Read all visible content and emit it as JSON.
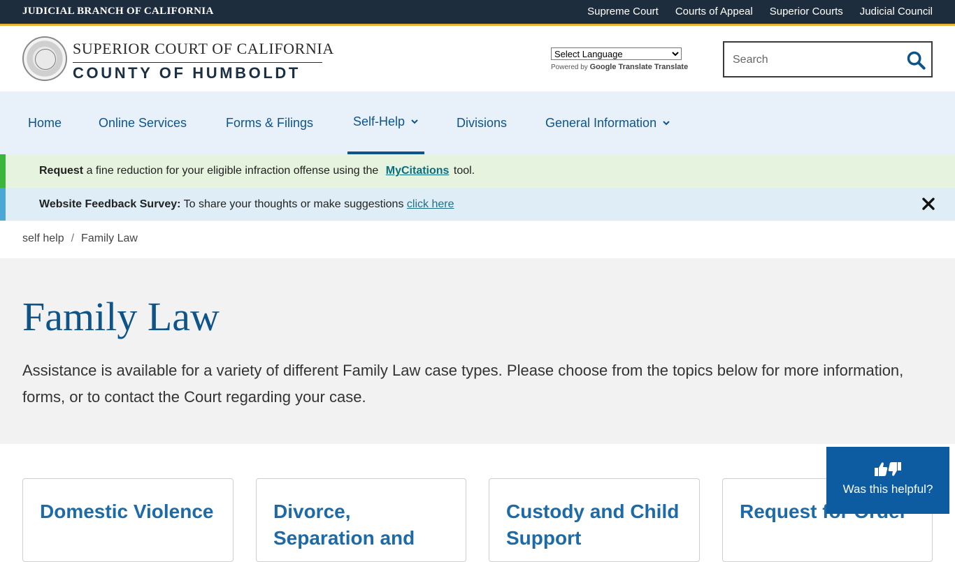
{
  "topbar": {
    "brand": "JUDICIAL BRANCH OF CALIFORNIA",
    "links": [
      "Supreme Court",
      "Courts of Appeal",
      "Superior Courts",
      "Judicial Council"
    ]
  },
  "header": {
    "line1": "SUPERIOR COURT OF CALIFORNIA",
    "line2": "COUNTY OF HUMBOLDT",
    "language_select": "Select Language",
    "powered_by": "Powered by",
    "translate_text": "Google Translate Translate",
    "search_placeholder": "Search"
  },
  "nav": {
    "items": [
      {
        "label": "Home"
      },
      {
        "label": "Online Services"
      },
      {
        "label": "Forms & Filings"
      },
      {
        "label": "Self-Help"
      },
      {
        "label": "Divisions"
      },
      {
        "label": "General Information"
      }
    ],
    "active": "Self-Help"
  },
  "alerts": {
    "green": {
      "bold": "Request",
      "text": " a fine reduction for your eligible infraction offense using the ",
      "link": "MyCitations",
      "tail": " tool."
    },
    "blue": {
      "bold": "Website Feedback Survey:",
      "text": " To share your thoughts or make suggestions ",
      "link": "click here"
    }
  },
  "breadcrumb": {
    "parent": "self help",
    "separator": "/",
    "current": "Family Law"
  },
  "hero": {
    "title": "Family Law",
    "description": "Assistance is available for a variety of different Family Law case types.  Please choose from the topics below for more information, forms, or to contact the Court regarding your case."
  },
  "cards": [
    {
      "title": "Domestic Violence"
    },
    {
      "title": "Divorce, Separation and"
    },
    {
      "title": "Custody and Child Support"
    },
    {
      "title": "Request for Order"
    }
  ],
  "helpful": {
    "label": "Was this helpful?"
  },
  "colors": {
    "topbar": "#1e2d3d",
    "accent_gold": "#e8b230",
    "brand_blue": "#0e5488",
    "alert_green": "#3bb53b",
    "alert_blue": "#4ba7d4"
  }
}
